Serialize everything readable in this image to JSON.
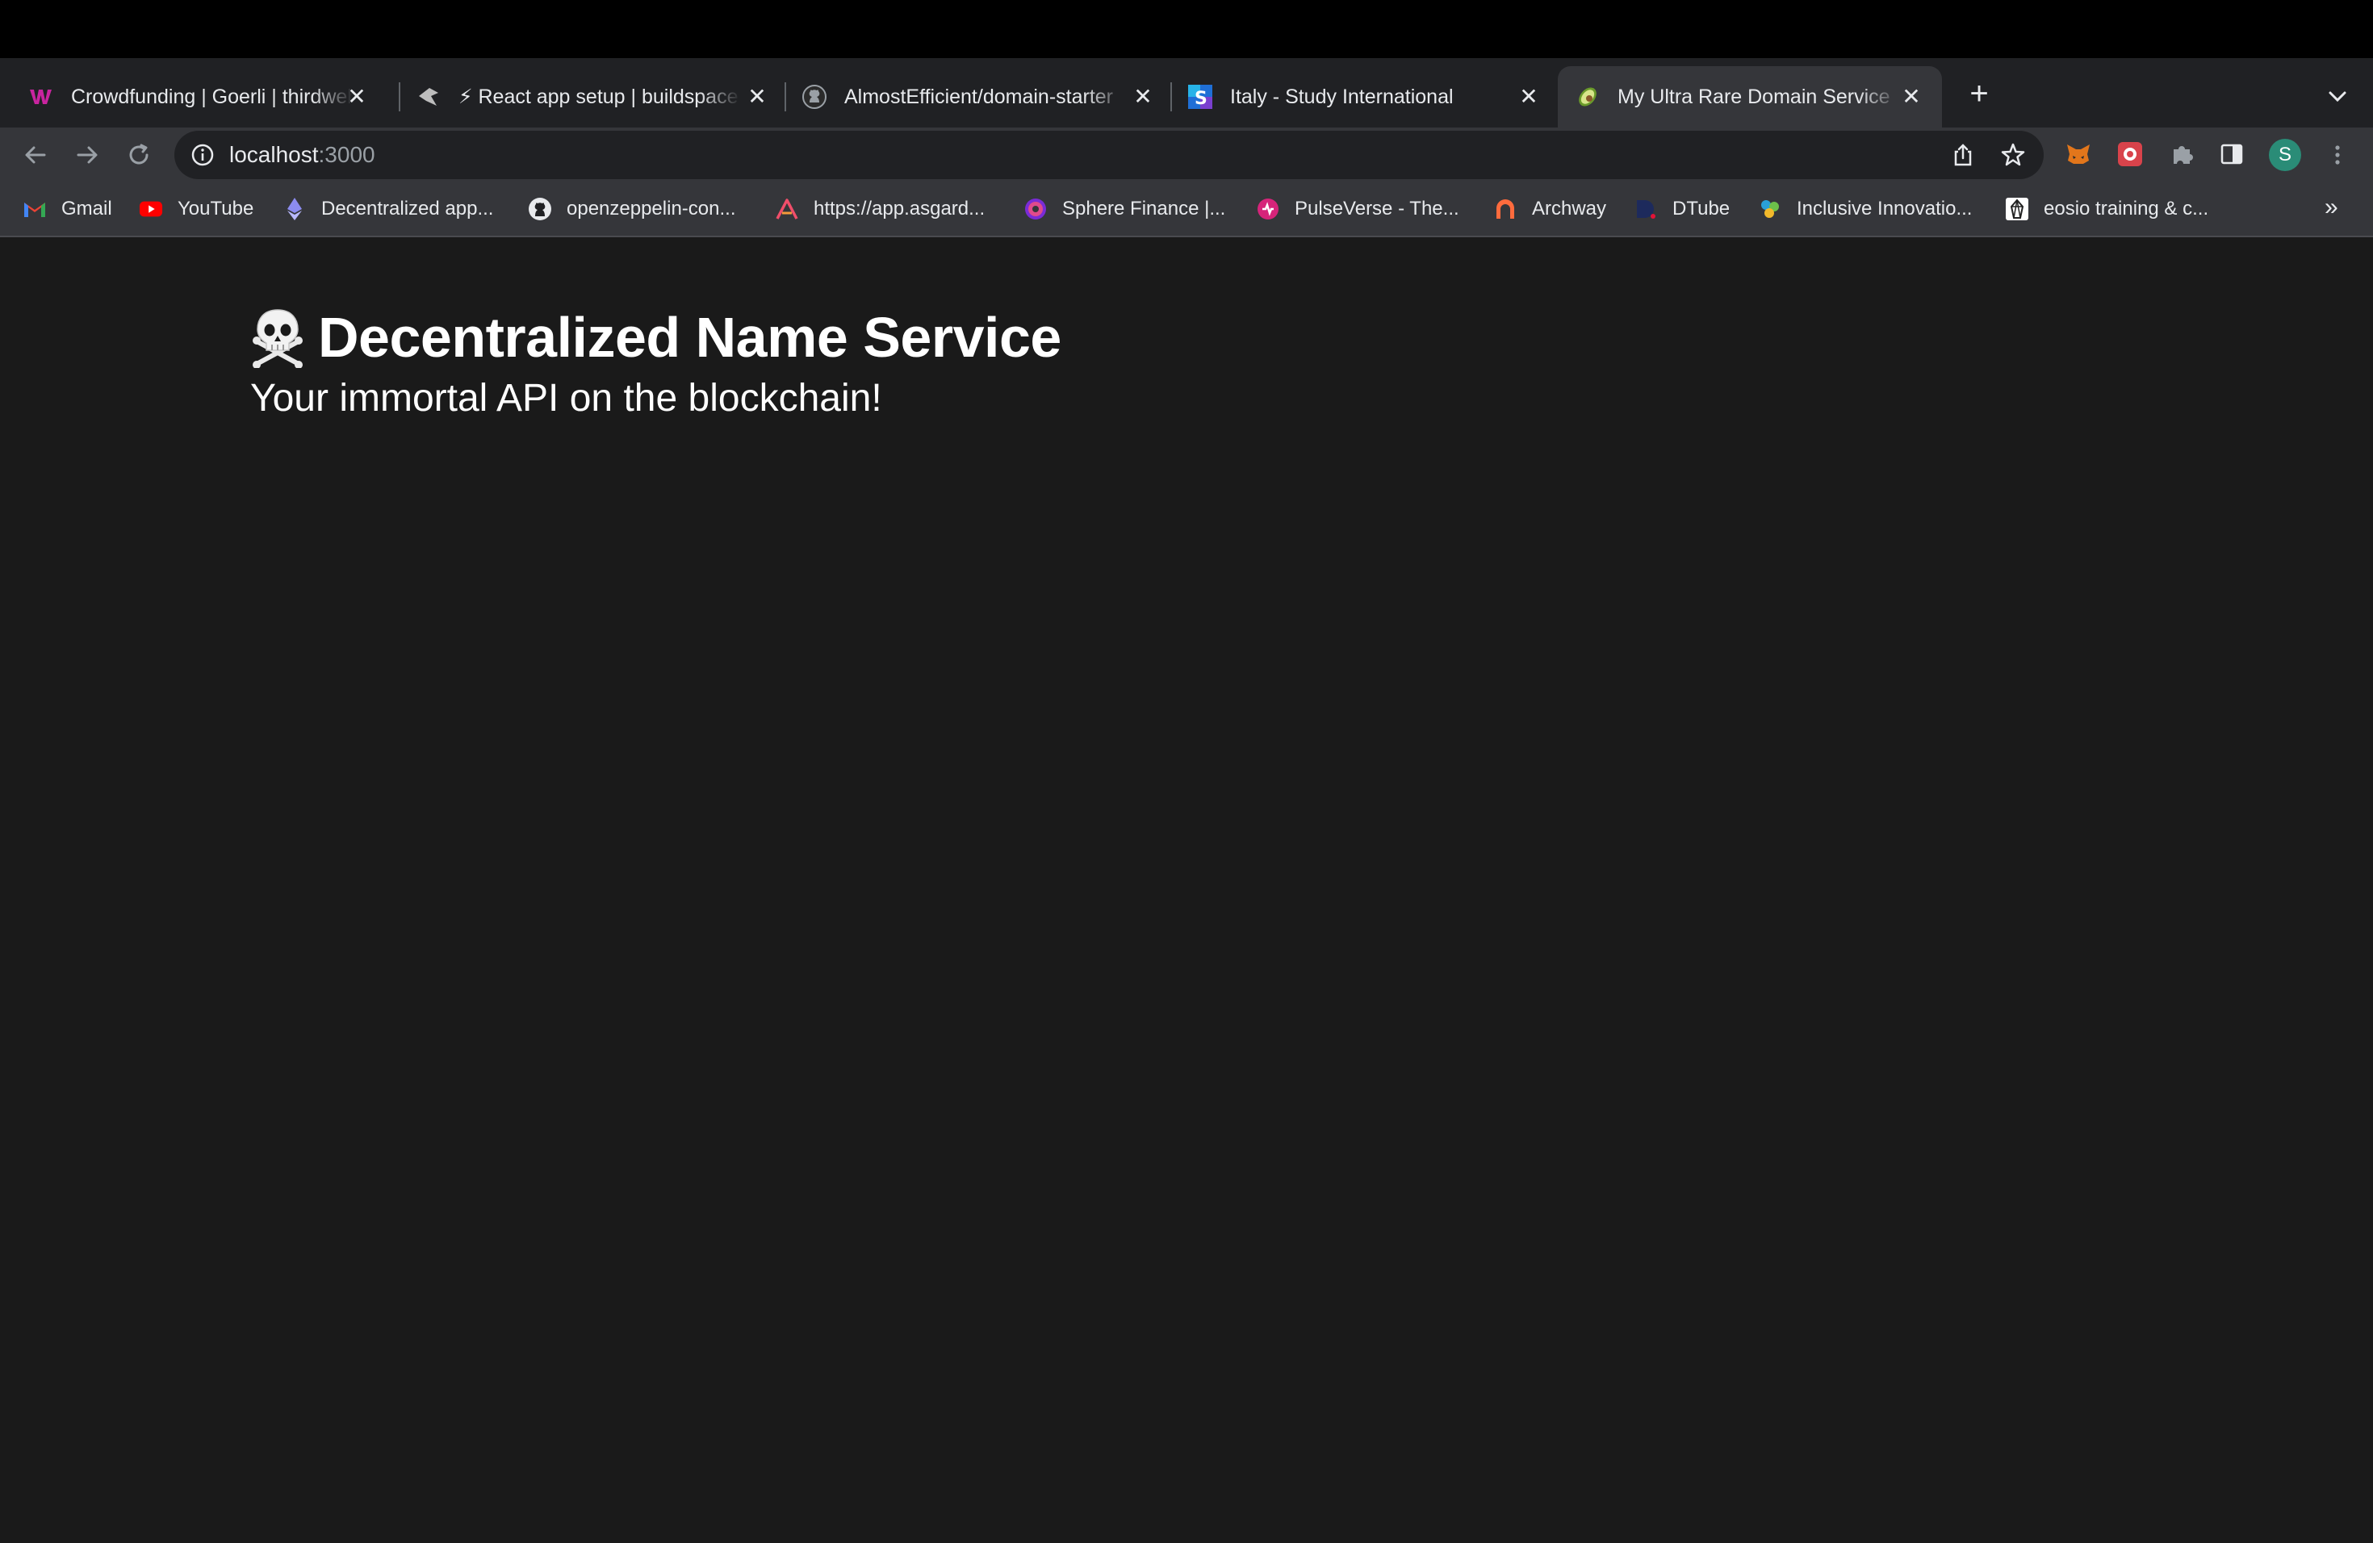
{
  "browser": {
    "tabs": [
      {
        "title": "Crowdfunding | Goerli | thirdweb",
        "favicon": "thirdweb-icon",
        "active": false
      },
      {
        "title": "⚡ React app setup | buildspace",
        "favicon": "buildspace-icon",
        "active": false
      },
      {
        "title": "AlmostEfficient/domain-starter",
        "favicon": "github-icon",
        "active": false
      },
      {
        "title": "Italy - Study International",
        "favicon": "study-international-icon",
        "active": false
      },
      {
        "title": "My Ultra Rare Domain Service",
        "favicon": "avocado-icon",
        "active": true
      }
    ],
    "close_glyph": "✕",
    "new_tab_glyph": "+",
    "address": {
      "host": "localhost",
      "port": ":3000"
    },
    "profile_initial": "S",
    "bookmarks": [
      {
        "label": "Gmail",
        "icon": "gmail-icon"
      },
      {
        "label": "YouTube",
        "icon": "youtube-icon"
      },
      {
        "label": "Decentralized app...",
        "icon": "ethereum-icon"
      },
      {
        "label": "openzeppelin-con...",
        "icon": "github-icon"
      },
      {
        "label": "https://app.asgard...",
        "icon": "asgard-icon"
      },
      {
        "label": "Sphere Finance |...",
        "icon": "sphere-icon"
      },
      {
        "label": "PulseVerse - The...",
        "icon": "pulseverse-icon"
      },
      {
        "label": "Archway",
        "icon": "archway-icon"
      },
      {
        "label": "DTube",
        "icon": "dtube-icon"
      },
      {
        "label": "Inclusive Innovatio...",
        "icon": "inclusive-icon"
      },
      {
        "label": "eosio training & c...",
        "icon": "eosio-icon"
      }
    ],
    "bookmarks_overflow": "»"
  },
  "page": {
    "title": "Decentralized Name Service",
    "subtitle": "Your immortal API on the blockchain!"
  },
  "colors": {
    "page_background": "#1a1a1a",
    "toolbar": "#35363a",
    "tabstrip": "#202124",
    "text": "#e8eaed"
  }
}
